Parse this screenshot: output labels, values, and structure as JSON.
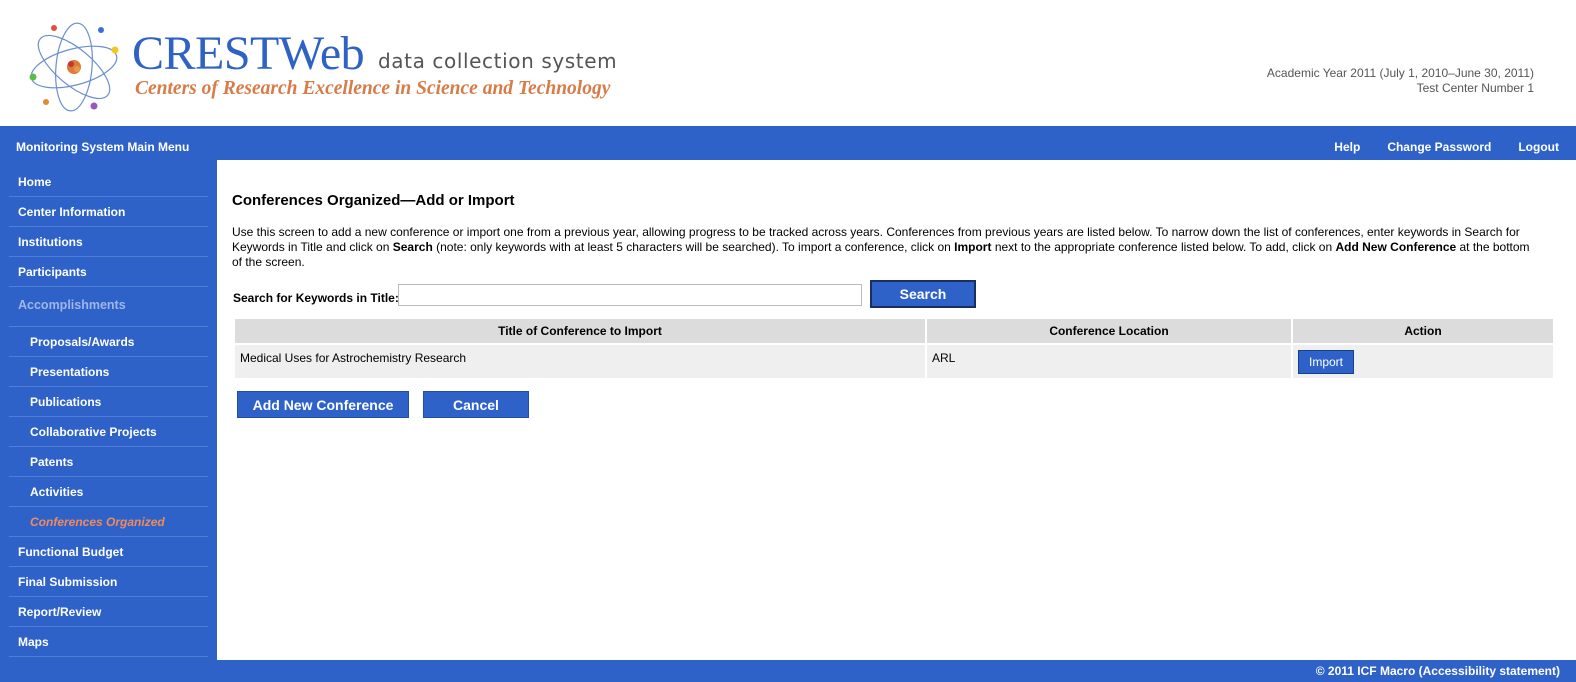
{
  "header": {
    "brand_title": "CRESTWeb",
    "brand_subtitle": "data collection system",
    "brand_tagline": "Centers of Research Excellence in Science and Technology",
    "academic_year": "Academic Year 2011 (July 1, 2010–June 30, 2011)",
    "center_name": "Test Center Number 1"
  },
  "topbar": {
    "menu_title": "Monitoring System Main Menu",
    "links": [
      "Help",
      "Change Password",
      "Logout"
    ]
  },
  "sidebar": {
    "items": [
      "Home",
      "Center Information",
      "Institutions",
      "Participants",
      "Accomplishments",
      "Proposals/Awards",
      "Presentations",
      "Publications",
      "Collaborative Projects",
      "Patents",
      "Activities",
      "Conferences Organized",
      "Functional Budget",
      "Final Submission",
      "Report/Review",
      "Maps"
    ],
    "current": "Conferences Organized"
  },
  "main": {
    "title": "Conferences Organized—Add or Import",
    "intro_parts": [
      "Use this screen to add a new conference or import one from a previous year, allowing progress to be tracked across years. Conferences from previous years are listed below. To narrow down the list of conferences, enter keywords in Search for Keywords in Title and click on ",
      "Search",
      " (note: only keywords with at least 5 characters will be searched). To import a conference, click on ",
      "Import",
      " next to the appropriate conference listed below. To add, click on ",
      "Add New Conference",
      " at the bottom of the screen."
    ],
    "search": {
      "label": "Search for Keywords in Title:",
      "value": "",
      "button": "Search"
    },
    "table": {
      "headers": [
        "Title of Conference to Import",
        "Conference Location",
        "Action"
      ],
      "rows": [
        {
          "title": "Medical Uses for Astrochemistry Research",
          "location": "ARL",
          "action": "Import"
        }
      ]
    },
    "add_button": "Add New Conference",
    "cancel_button": "Cancel"
  },
  "footer": {
    "copyright": "© 2011 ICF Macro (Accessibility statement)"
  },
  "colors": {
    "primary_blue": "#2e62c9",
    "tagline_orange": "#d77c48",
    "current_item": "#f08a5a"
  }
}
